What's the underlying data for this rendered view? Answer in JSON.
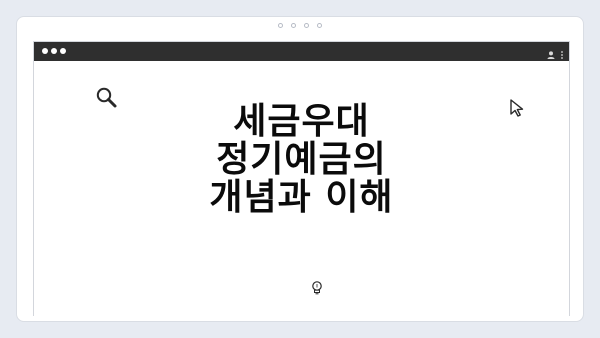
{
  "window": {
    "headline_lines": [
      "세금우대",
      "정기예금의",
      "개념과 이해"
    ]
  },
  "icons": {
    "top_dots": "dots-icon",
    "search": "magnifier-icon",
    "cursor": "cursor-arrow-icon",
    "bulb": "lightbulb-icon",
    "profile": "user-icon",
    "menu": "kebab-menu-icon"
  }
}
